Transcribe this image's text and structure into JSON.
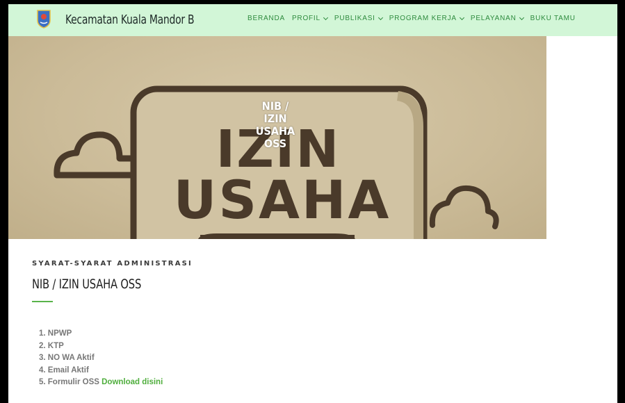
{
  "header": {
    "site_title": "Kecamatan Kuala Mandor B",
    "logo_icon": "regency-crest-icon",
    "nav": [
      {
        "label": "BERANDA",
        "has_dropdown": false
      },
      {
        "label": "PROFIL",
        "has_dropdown": true
      },
      {
        "label": "PUBLIKASI",
        "has_dropdown": true
      },
      {
        "label": "PROGRAM KERJA",
        "has_dropdown": true
      },
      {
        "label": "PELAYANAN",
        "has_dropdown": true
      },
      {
        "label": "BUKU TAMU",
        "has_dropdown": false
      }
    ]
  },
  "hero": {
    "caption": [
      "NIB /",
      "IZIN",
      "USAHA",
      "OSS"
    ],
    "image_text": [
      "IZIN",
      "USAHA"
    ]
  },
  "content": {
    "eyebrow": "SYARAT-SYARAT ADMINISTRASI",
    "title": "NIB / IZIN USAHA OSS",
    "requirements": [
      {
        "text": "1. NPWP"
      },
      {
        "text": "2. KTP"
      },
      {
        "text": "3. NO WA Aktif"
      },
      {
        "text": "4. Email Aktif"
      },
      {
        "text": "5. Formulir OSS ",
        "link": "Download disini"
      }
    ]
  },
  "colors": {
    "nav_bg": "#d2f6d7",
    "nav_text": "#2e8b3e",
    "accent_green": "#4fae3d",
    "hero_bg": "#cbbb98",
    "hero_ink": "#4a3a2a"
  }
}
